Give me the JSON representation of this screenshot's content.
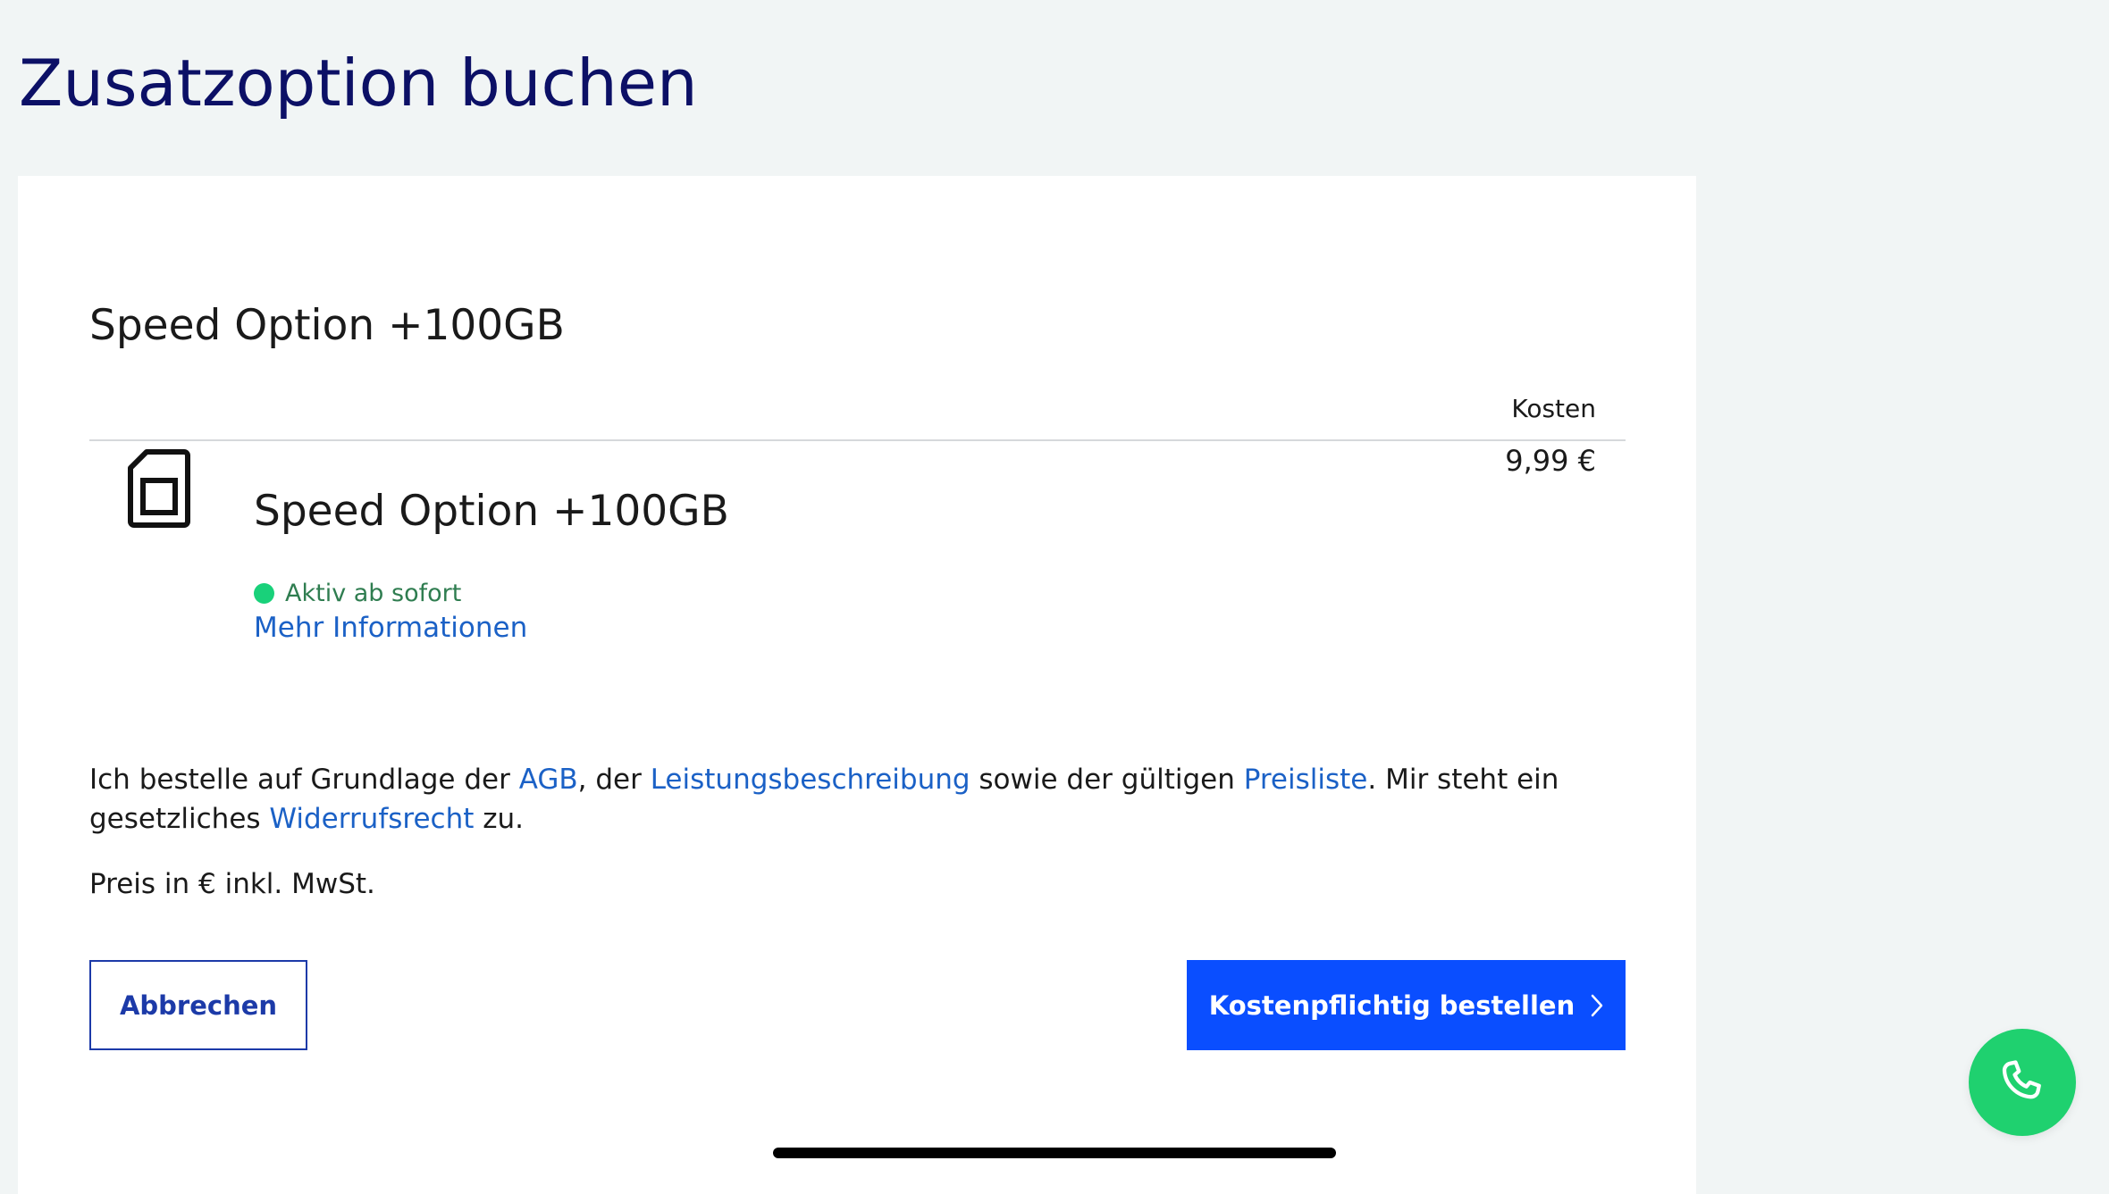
{
  "page": {
    "title": "Zusatzoption buchen"
  },
  "option": {
    "heading": "Speed Option +100GB",
    "cost_header": "Kosten",
    "item_name": "Speed Option +100GB",
    "price": "9,99 €",
    "status": "Aktiv ab sofort",
    "status_color": "#19d17a",
    "more_info_link": "Mehr Informationen",
    "icon": "sim-card-icon"
  },
  "terms": {
    "prefix": "Ich bestelle auf Grundlage der ",
    "agb_link": "AGB",
    "sep1": ", der ",
    "service_description_link": "Leistungsbeschreibung",
    "sep2": " sowie der gültigen ",
    "price_list_link": "Preisliste",
    "sep3": ". Mir steht ein gesetzliches ",
    "withdrawal_link": "Widerrufsrecht",
    "suffix": " zu.",
    "vat_note": "Preis in € inkl. MwSt."
  },
  "buttons": {
    "cancel_label": "Abbrechen",
    "order_label": "Kostenpflichtig bestellen",
    "order_icon": "chevron-right-icon"
  },
  "fab": {
    "icon": "phone-icon"
  },
  "colors": {
    "title": "#0c1066",
    "link": "#1b61c6",
    "primary_button": "#0a4eff",
    "cancel_border": "#1c3aa8",
    "fab": "#1fd16f",
    "background": "#f1f5f5"
  }
}
